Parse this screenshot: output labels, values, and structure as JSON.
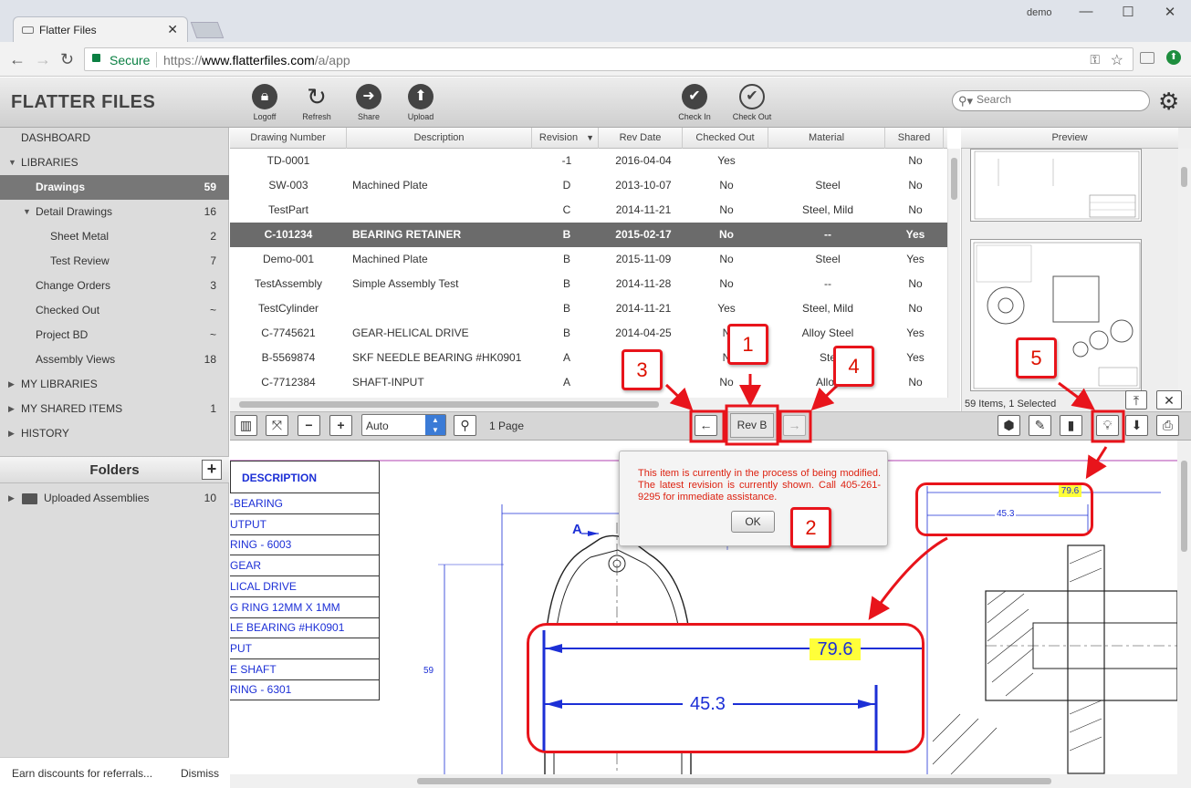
{
  "browser": {
    "tab_title": "Flatter Files",
    "user": "demo",
    "secure_label": "Secure",
    "url_prefix": "https://",
    "url_domain": "www.flatterfiles.com",
    "url_path": "/a/app"
  },
  "app": {
    "logo": "FLATTER FILES",
    "toolbar": [
      {
        "label": "Logoff",
        "icon": "lock-icon"
      },
      {
        "label": "Refresh",
        "icon": "refresh-icon"
      },
      {
        "label": "Share",
        "icon": "share-arrow-icon"
      },
      {
        "label": "Upload",
        "icon": "upload-arrow-icon"
      },
      {
        "label": "Check In",
        "icon": "check-in-icon"
      },
      {
        "label": "Check Out",
        "icon": "check-out-icon"
      }
    ],
    "search_placeholder": "Search"
  },
  "sidebar": {
    "items": [
      {
        "label": "DASHBOARD",
        "count": ""
      },
      {
        "label": "LIBRARIES",
        "count": ""
      },
      {
        "label": "Drawings",
        "count": "59"
      },
      {
        "label": "Detail Drawings",
        "count": "16"
      },
      {
        "label": "Sheet Metal",
        "count": "2"
      },
      {
        "label": "Test Review",
        "count": "7"
      },
      {
        "label": "Change Orders",
        "count": "3"
      },
      {
        "label": "Checked Out",
        "count": "~"
      },
      {
        "label": "Project BD",
        "count": "~"
      },
      {
        "label": "Assembly Views",
        "count": "18"
      },
      {
        "label": "MY LIBRARIES",
        "count": ""
      },
      {
        "label": "MY SHARED ITEMS",
        "count": "1"
      },
      {
        "label": "HISTORY",
        "count": ""
      }
    ],
    "folders_title": "Folders",
    "folders": [
      {
        "label": "Uploaded Assemblies",
        "count": "10"
      }
    ],
    "footer_text": "Earn discounts for referrals...",
    "dismiss": "Dismiss"
  },
  "table": {
    "columns": [
      "Drawing Number",
      "Description",
      "Revision",
      "Rev Date",
      "Checked Out",
      "Material",
      "Shared"
    ],
    "rows": [
      [
        "TD-0001",
        "",
        "-1",
        "2016-04-04",
        "Yes",
        "",
        "No"
      ],
      [
        "SW-003",
        "Machined Plate",
        "D",
        "2013-10-07",
        "No",
        "Steel",
        "No"
      ],
      [
        "TestPart",
        "",
        "C",
        "2014-11-21",
        "No",
        "Steel, Mild",
        "No"
      ],
      [
        "C-101234",
        "BEARING RETAINER",
        "B",
        "2015-02-17",
        "No",
        "--",
        "Yes"
      ],
      [
        "Demo-001",
        "Machined Plate",
        "B",
        "2015-11-09",
        "No",
        "Steel",
        "Yes"
      ],
      [
        "TestAssembly",
        "Simple Assembly Test",
        "B",
        "2014-11-28",
        "No",
        "--",
        "No"
      ],
      [
        "TestCylinder",
        "",
        "B",
        "2014-11-21",
        "Yes",
        "Steel, Mild",
        "No"
      ],
      [
        "C-7745621",
        "GEAR-HELICAL DRIVE",
        "B",
        "2014-04-25",
        "N",
        "Alloy Steel",
        "Yes"
      ],
      [
        "B-5569874",
        "SKF NEEDLE BEARING #HK0901",
        "A",
        "2",
        "N",
        "Ste",
        "Yes"
      ],
      [
        "C-7712384",
        "SHAFT-INPUT",
        "A",
        "2",
        "No",
        "Alloy",
        "No"
      ]
    ],
    "selected_index": 3
  },
  "preview": {
    "title": "Preview",
    "items_info": "59 Items, 1 Selected"
  },
  "viewer": {
    "zoom": "Auto",
    "pages": "1 Page",
    "revision": "Rev B",
    "popup_message": "This item is currently in the process of being modified. The latest revision is currently shown. Call 405-261-9295 for immediate assistance.",
    "popup_ok": "OK",
    "bom_header": "DESCRIPTION",
    "bom_rows": [
      "-BEARING",
      "UTPUT",
      "RING - 6003",
      "GEAR",
      "LICAL DRIVE",
      "G RING 12MM  X 1MM",
      "LE BEARING #HK0901",
      "PUT",
      "E SHAFT",
      "RING - 6301"
    ],
    "dim_top": "79.6",
    "dim_bottom": "45.3",
    "dim_vertical": "59",
    "section_label": "A"
  },
  "callouts": [
    "1",
    "2",
    "3",
    "4",
    "5"
  ]
}
